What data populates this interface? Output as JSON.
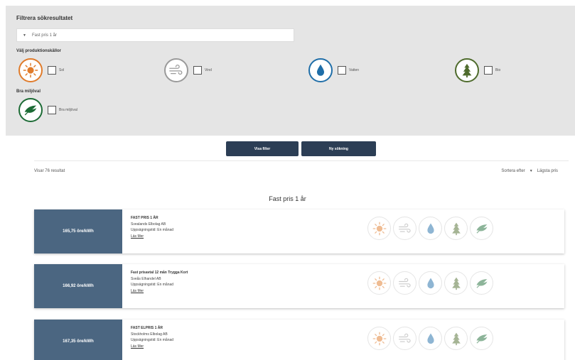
{
  "filters": {
    "title": "Filtrera sökresultatet",
    "select_value": "Fast pris 1 år",
    "sources_label": "Välj produktionskällor",
    "sources": [
      {
        "label": "Sol",
        "icon": "sun-icon",
        "color": "#e07b2a"
      },
      {
        "label": "Vind",
        "icon": "wind-icon",
        "color": "#9a9a9a"
      },
      {
        "label": "Vatten",
        "icon": "water-drop-icon",
        "color": "#1f6ea8"
      },
      {
        "label": "Bio",
        "icon": "tree-icon",
        "color": "#4e6b2c"
      }
    ],
    "eco_label": "Bra miljöval",
    "eco_checkbox_label": "Bra miljöval",
    "eco_color": "#1c6b35"
  },
  "buttons": {
    "show_filter": "Visa filter",
    "new_search": "Ny sökning"
  },
  "results": {
    "count_text": "Visar 76 resultat",
    "sort_label": "Sortera efter",
    "sort_value": "Lägsta pris",
    "group_heading": "Fast pris 1 år",
    "items": [
      {
        "price": "165,75 öre/kWh",
        "name": "FAST PRIS 1 ÅR",
        "company": "Svealands Elbolag AB",
        "notice": "Uppsägningstid: En månad",
        "link": "Läs Mer"
      },
      {
        "price": "166,92 öre/kWh",
        "name": "Fast prisavtal 12 mån Trygga Kort",
        "company": "Sveås Elhandel AB",
        "notice": "Uppsägningstid: En månad",
        "link": "Läs Mer"
      },
      {
        "price": "167,35 öre/kWh",
        "name": "FAST ELPRIS 1 ÅR",
        "company": "Stockholms Elbolag AB",
        "notice": "Uppsägningstid: En månad",
        "link": "Läs Mer"
      }
    ]
  }
}
